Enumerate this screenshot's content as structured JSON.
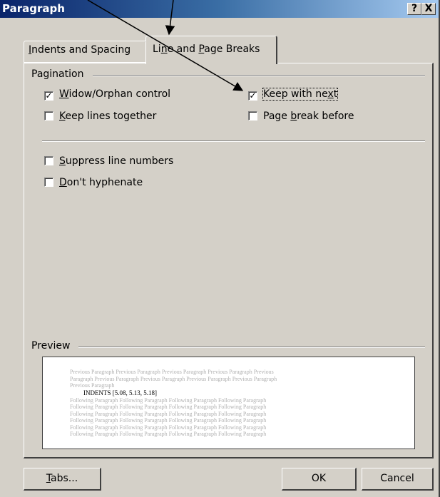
{
  "window": {
    "title": "Paragraph",
    "help_label": "?",
    "close_label": "X"
  },
  "tabs": [
    {
      "label": "Indents and Spacing",
      "selected": false
    },
    {
      "label": "Line and Page Breaks",
      "selected": true
    }
  ],
  "pagination": {
    "group_label": "Pagination",
    "widow_orphan_control": {
      "label": "Widow/Orphan control",
      "checked": true
    },
    "keep_with_next": {
      "label": "Keep with next",
      "checked": true
    },
    "keep_lines_together": {
      "label": "Keep lines together",
      "checked": false
    },
    "page_break_before": {
      "label": "Page break before",
      "checked": false
    }
  },
  "options": {
    "suppress_line_numbers": {
      "label": "Suppress line numbers",
      "checked": false
    },
    "dont_hyphenate": {
      "label": "Don't hyphenate",
      "checked": false
    }
  },
  "preview": {
    "group_label": "Preview",
    "previous_lines": [
      "Previous Paragraph Previous Paragraph Previous Paragraph Previous Paragraph Previous",
      "Paragraph Previous Paragraph Previous Paragraph Previous Paragraph Previous Paragraph",
      "Previous Paragraph"
    ],
    "current_text": "INDENTS [5.08, 5.13, 5.18]",
    "following_lines": [
      "Following Paragraph Following Paragraph Following Paragraph Following Paragraph",
      "Following Paragraph Following Paragraph Following Paragraph Following Paragraph",
      "Following Paragraph Following Paragraph Following Paragraph Following Paragraph",
      "Following Paragraph Following Paragraph Following Paragraph Following Paragraph",
      "Following Paragraph Following Paragraph Following Paragraph Following Paragraph",
      "Following Paragraph Following Paragraph Following Paragraph Following Paragraph"
    ]
  },
  "buttons": {
    "tabs_label": "Tabs...",
    "ok_label": "OK",
    "cancel_label": "Cancel"
  },
  "colors": {
    "dialog_bg": "#d4d0c8",
    "titlebar_start": "#0a246a",
    "titlebar_end": "#a6caf0",
    "annotation_arrow": "#000000"
  }
}
